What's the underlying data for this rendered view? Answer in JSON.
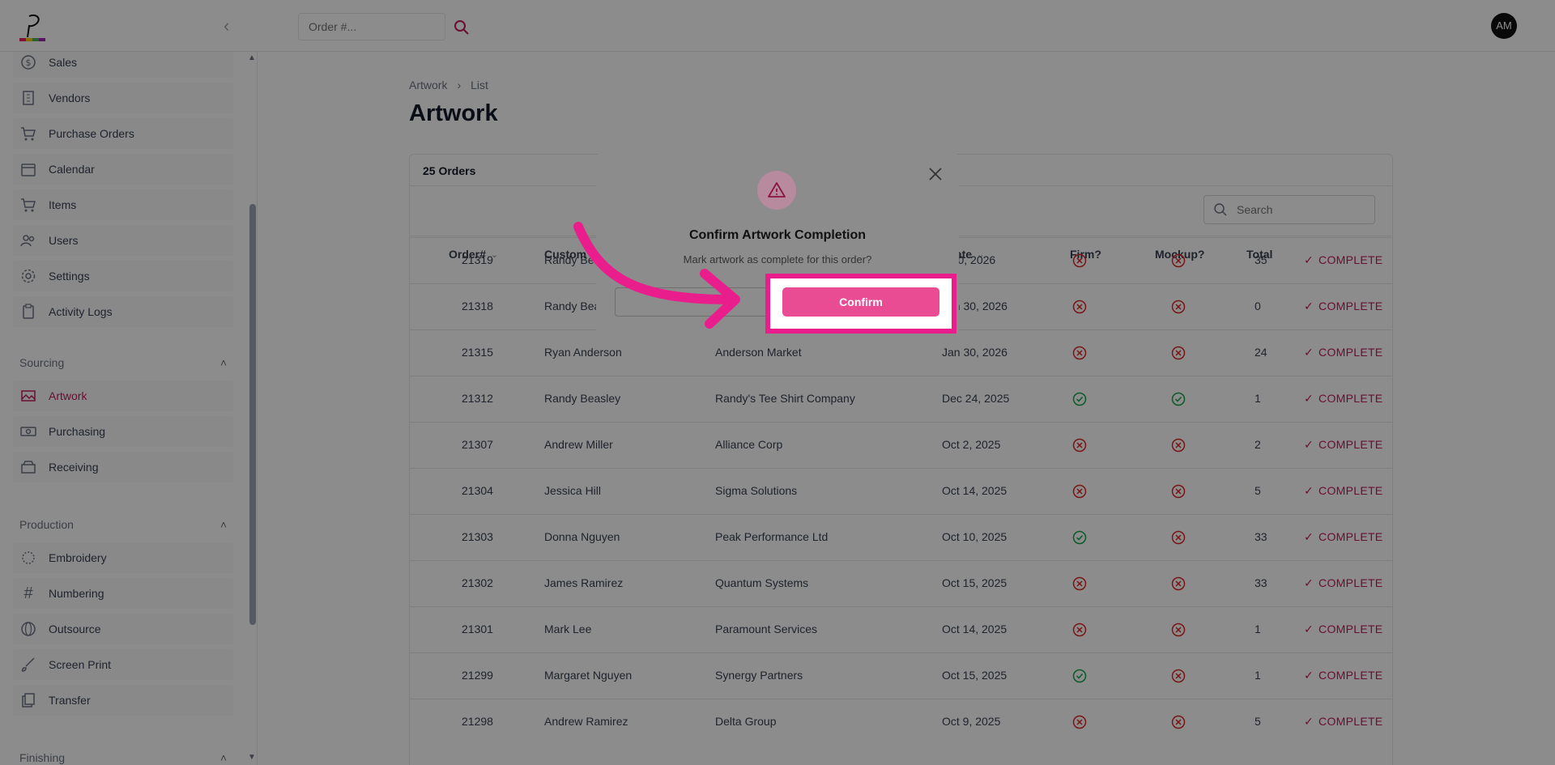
{
  "header": {
    "order_search_placeholder": "Order #...",
    "avatar_initials": "AM"
  },
  "sidebar": {
    "items_top": [
      {
        "label": "Sales",
        "icon": "dollar-icon"
      },
      {
        "label": "Vendors",
        "icon": "building-icon"
      },
      {
        "label": "Purchase Orders",
        "icon": "cart-icon"
      },
      {
        "label": "Calendar",
        "icon": "calendar-icon"
      },
      {
        "label": "Items",
        "icon": "cart-icon"
      },
      {
        "label": "Users",
        "icon": "users-icon"
      },
      {
        "label": "Settings",
        "icon": "gear-icon"
      },
      {
        "label": "Activity Logs",
        "icon": "clipboard-icon"
      }
    ],
    "sourcing_title": "Sourcing",
    "sourcing_items": [
      {
        "label": "Artwork",
        "icon": "image-icon",
        "active": true
      },
      {
        "label": "Purchasing",
        "icon": "cash-icon"
      },
      {
        "label": "Receiving",
        "icon": "box-icon"
      }
    ],
    "production_title": "Production",
    "production_items": [
      {
        "label": "Embroidery",
        "icon": "embroidery-icon"
      },
      {
        "label": "Numbering",
        "icon": "hash-icon"
      },
      {
        "label": "Outsource",
        "icon": "globe-icon"
      },
      {
        "label": "Screen Print",
        "icon": "brush-icon"
      },
      {
        "label": "Transfer",
        "icon": "transfer-icon"
      }
    ],
    "finishing_title": "Finishing"
  },
  "breadcrumb": {
    "root": "Artwork",
    "current": "List"
  },
  "page_title": "Artwork",
  "table": {
    "count_label": "25 Orders",
    "search_placeholder": "Search",
    "columns": {
      "order": "Order#",
      "customer": "Custom",
      "due_date": "e Date",
      "firm": "Firm?",
      "mockup": "Mockup?",
      "total": "Total"
    },
    "status_label": "COMPLETE",
    "rows": [
      {
        "order": "21319",
        "customer": "Randy Bea",
        "company": "",
        "date": "n 30, 2026",
        "firm": false,
        "mockup": false,
        "total": "35"
      },
      {
        "order": "21318",
        "customer": "Randy Beasley",
        "company": "Randy's Tee Shirt Company",
        "date": "Jan 30, 2026",
        "firm": false,
        "mockup": false,
        "total": "0"
      },
      {
        "order": "21315",
        "customer": "Ryan Anderson",
        "company": "Anderson Market",
        "date": "Jan 30, 2026",
        "firm": false,
        "mockup": false,
        "total": "24"
      },
      {
        "order": "21312",
        "customer": "Randy Beasley",
        "company": "Randy's Tee Shirt Company",
        "date": "Dec 24, 2025",
        "firm": true,
        "mockup": true,
        "total": "1"
      },
      {
        "order": "21307",
        "customer": "Andrew Miller",
        "company": "Alliance Corp",
        "date": "Oct 2, 2025",
        "firm": false,
        "mockup": false,
        "total": "2"
      },
      {
        "order": "21304",
        "customer": "Jessica Hill",
        "company": "Sigma Solutions",
        "date": "Oct 14, 2025",
        "firm": false,
        "mockup": false,
        "total": "5"
      },
      {
        "order": "21303",
        "customer": "Donna Nguyen",
        "company": "Peak Performance Ltd",
        "date": "Oct 10, 2025",
        "firm": true,
        "mockup": false,
        "total": "33"
      },
      {
        "order": "21302",
        "customer": "James Ramirez",
        "company": "Quantum Systems",
        "date": "Oct 15, 2025",
        "firm": false,
        "mockup": false,
        "total": "33"
      },
      {
        "order": "21301",
        "customer": "Mark Lee",
        "company": "Paramount Services",
        "date": "Oct 14, 2025",
        "firm": false,
        "mockup": false,
        "total": "1"
      },
      {
        "order": "21299",
        "customer": "Margaret Nguyen",
        "company": "Synergy Partners",
        "date": "Oct 15, 2025",
        "firm": true,
        "mockup": false,
        "total": "1"
      },
      {
        "order": "21298",
        "customer": "Andrew Ramirez",
        "company": "Delta Group",
        "date": "Oct 9, 2025",
        "firm": false,
        "mockup": false,
        "total": "5"
      }
    ]
  },
  "modal": {
    "title": "Confirm Artwork Completion",
    "message": "Mark artwork as complete for this order?",
    "confirm_label": "Confirm"
  },
  "colors": {
    "accent": "#c2185b",
    "highlight": "#e91e8c",
    "confirm": "#ea4c94",
    "success": "#16a34a",
    "danger": "#dc2626"
  }
}
